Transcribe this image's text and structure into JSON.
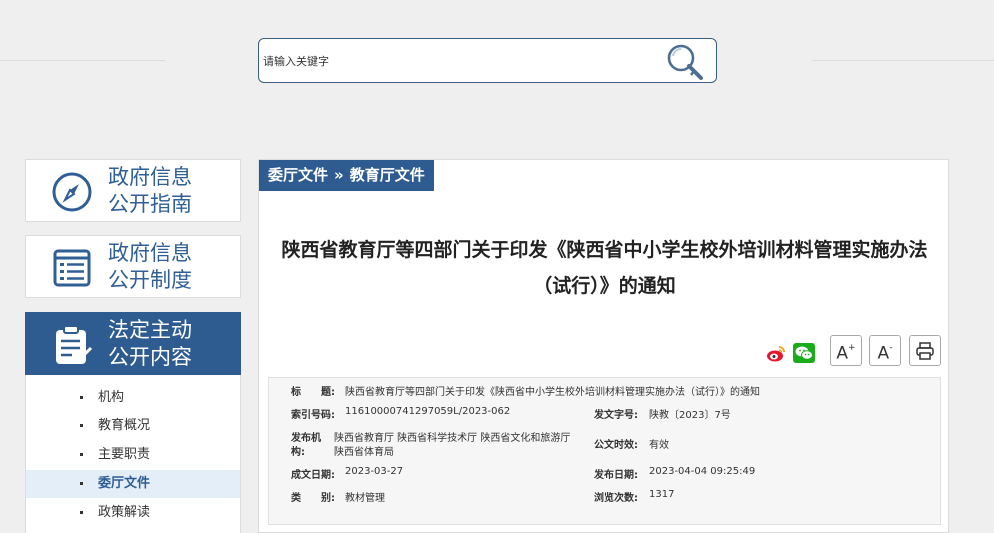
{
  "search": {
    "placeholder": "请输入关键字"
  },
  "sidebar": {
    "cards": [
      {
        "line1": "政府信息",
        "line2": "公开指南",
        "icon": "compass-icon"
      },
      {
        "line1": "政府信息",
        "line2": "公开制度",
        "icon": "list-doc-icon"
      },
      {
        "line1": "法定主动",
        "line2": "公开内容",
        "icon": "clipboard-icon"
      }
    ],
    "items": [
      {
        "label": "机构"
      },
      {
        "label": "教育概况"
      },
      {
        "label": "主要职责"
      },
      {
        "label": "委厅文件",
        "active": true
      },
      {
        "label": "政策解读"
      }
    ]
  },
  "breadcrumb": {
    "level1": "委厅文件",
    "separator": "»",
    "level2": "教育厅文件"
  },
  "doc": {
    "title_line1": "陕西省教育厅等四部门关于印发《陕西省中小学生校外培训材料管理实施办法",
    "title_line2": "（试行）》的通知"
  },
  "tools": {
    "icons": [
      "weibo-icon",
      "wechat-icon",
      "print-icon"
    ],
    "font_large": "A",
    "font_large_mark": "+",
    "font_small": "A",
    "font_small_mark": "-"
  },
  "info": {
    "title_label": "标　　题:",
    "title_value": "陕西省教育厅等四部门关于印发《陕西省中小学生校外培训材料管理实施办法（试行）》的通知",
    "index_label": "索引号码:",
    "index_value": "11610000741297059L/2023-062",
    "docno_label": "发文字号:",
    "docno_value": "陕教〔2023〕7号",
    "issuer_label_1": "发布机",
    "issuer_label_2": "构:",
    "issuer_value_1": "陕西省教育厅 陕西省科学技术厅 陕西省文化和旅游厅",
    "issuer_value_2": "陕西省体育局",
    "validity_label": "公文时效:",
    "validity_value": "有效",
    "created_label": "成文日期:",
    "created_value": "2023-03-27",
    "published_label": "发布日期:",
    "published_value": "2023-04-04 09:25:49",
    "category_label": "类　　别:",
    "category_value": "教材管理",
    "views_label": "浏览次数:",
    "views_value": "1317"
  },
  "colors": {
    "brand": "#2e5c91",
    "accent_text": "#2f5f95",
    "page_bg": "#efefef"
  }
}
